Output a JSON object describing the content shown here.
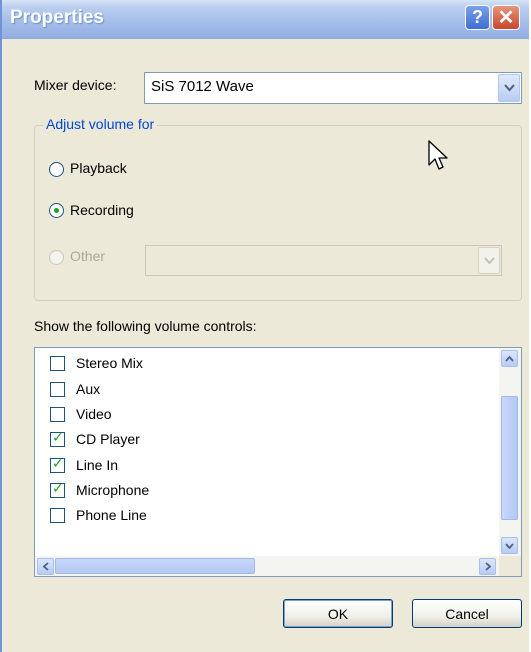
{
  "window": {
    "title": "Properties"
  },
  "titlebar": {
    "help_label": "?",
    "close_label": "✕"
  },
  "mixer": {
    "label": "Mixer device:",
    "selected": "SiS 7012 Wave"
  },
  "adjust": {
    "group_label": "Adjust volume for",
    "options": [
      {
        "label": "Playback",
        "checked": false,
        "enabled": true
      },
      {
        "label": "Recording",
        "checked": true,
        "enabled": true
      },
      {
        "label": "Other",
        "checked": false,
        "enabled": false
      }
    ],
    "other_selected": ""
  },
  "controls": {
    "label": "Show the following volume controls:",
    "items": [
      {
        "label": "Stereo Mix",
        "checked": false
      },
      {
        "label": "Aux",
        "checked": false
      },
      {
        "label": "Video",
        "checked": false
      },
      {
        "label": "CD Player",
        "checked": true
      },
      {
        "label": "Line In",
        "checked": true
      },
      {
        "label": "Microphone",
        "checked": true
      },
      {
        "label": "Phone Line",
        "checked": false
      }
    ]
  },
  "buttons": {
    "ok": "OK",
    "cancel": "Cancel"
  },
  "icons": {
    "combo_arrow": "chevron-down-icon",
    "scroll_up": "chevron-up-icon",
    "scroll_down": "chevron-down-icon",
    "scroll_left": "chevron-left-icon",
    "scroll_right": "chevron-right-icon",
    "cursor": "mouse-pointer-icon"
  },
  "colors": {
    "dialog_bg": "#ece9d8",
    "group_title": "#0046d5",
    "check": "#21a121",
    "accent": "#3f6ed2"
  }
}
